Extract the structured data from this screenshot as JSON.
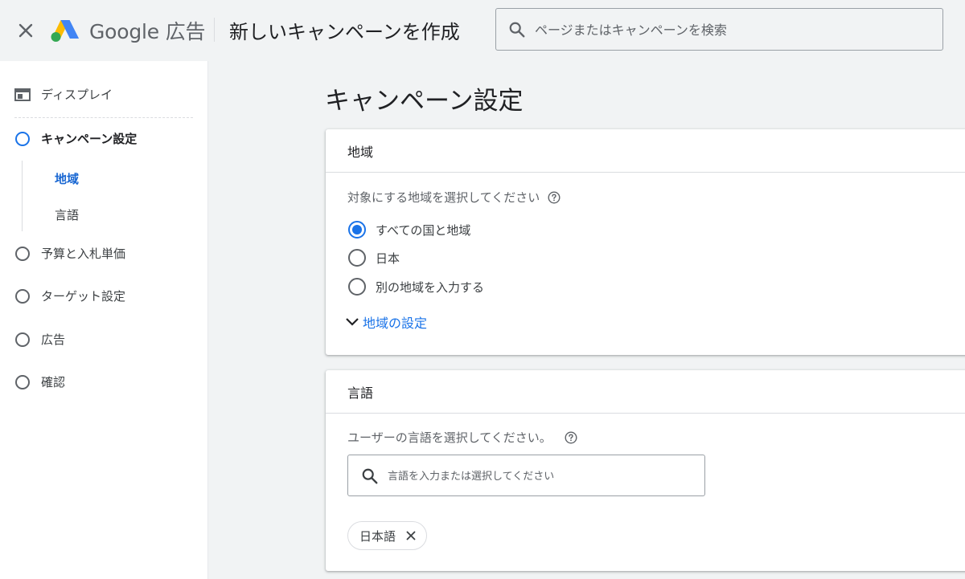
{
  "header": {
    "close_icon": "close-icon",
    "logo_icon": "google-ads-logo",
    "logo_text": "Google 広告",
    "title": "新しいキャンペーンを作成",
    "search": {
      "icon": "search-icon",
      "placeholder": "ページまたはキャンペーンを検索",
      "value": ""
    }
  },
  "sidebar": {
    "items": [
      {
        "label": "ディスプレイ",
        "icon": "display-icon"
      },
      {
        "label": "キャンペーン設定",
        "icon": "circle-icon",
        "active": true
      },
      {
        "label": "予算と入札単価",
        "icon": "circle-icon"
      },
      {
        "label": "ターゲット設定",
        "icon": "circle-icon"
      },
      {
        "label": "広告",
        "icon": "circle-icon"
      },
      {
        "label": "確認",
        "icon": "circle-icon"
      }
    ],
    "sub_items": [
      {
        "label": "地域",
        "active": true
      },
      {
        "label": "言語",
        "active": false
      }
    ]
  },
  "main": {
    "title": "キャンペーン設定",
    "location_card": {
      "header": "地域",
      "prompt": "対象にする地域を選択してください",
      "help_icon": "help-icon",
      "options": [
        {
          "label": "すべての国と地域",
          "checked": true
        },
        {
          "label": "日本",
          "checked": false
        },
        {
          "label": "別の地域を入力する",
          "checked": false
        }
      ],
      "expand_label": "地域の設定",
      "expand_icon": "chevron-down-icon"
    },
    "language_card": {
      "header": "言語",
      "prompt": "ユーザーの言語を選択してください。",
      "help_icon": "help-icon",
      "search": {
        "icon": "search-icon",
        "placeholder": "言語を入力または選択してください",
        "value": ""
      },
      "chips": [
        {
          "label": "日本語",
          "remove_icon": "close-icon"
        }
      ]
    }
  },
  "colors": {
    "accent": "#1a73e8",
    "background": "#f1f3f4",
    "card": "#ffffff"
  }
}
